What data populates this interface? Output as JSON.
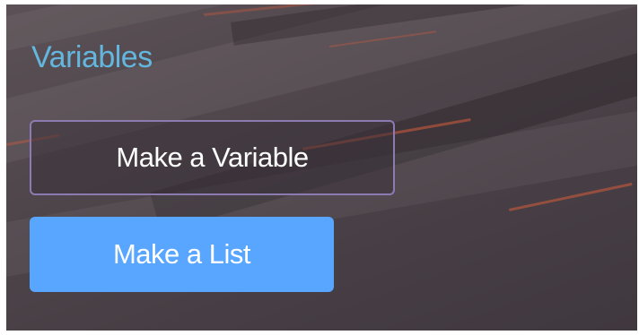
{
  "palette": {
    "category_title_color": "#63b7df",
    "variable_button_border": "#8c7bb3",
    "list_button_fill": "#58a6ff",
    "button_text_color": "#ffffff"
  },
  "category": {
    "title": "Variables"
  },
  "buttons": {
    "make_variable": "Make a Variable",
    "make_list": "Make a List"
  }
}
